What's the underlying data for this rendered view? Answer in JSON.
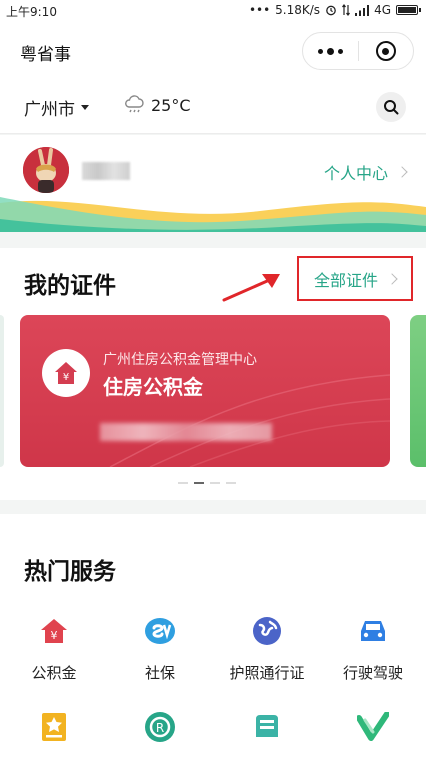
{
  "status_bar": {
    "time": "上午9:10",
    "dots": "•••",
    "speed": "5.18K/s",
    "network": "4G"
  },
  "header": {
    "title": "粤省事"
  },
  "location": {
    "city": "广州市",
    "temperature": "25°C"
  },
  "user": {
    "center_label": "个人中心"
  },
  "certificates": {
    "title": "我的证件",
    "all_label": "全部证件",
    "card": {
      "org": "广州住房公积金管理中心",
      "name": "住房公积金",
      "color": "#d43d50"
    },
    "page_count": 4,
    "active_page": 1
  },
  "services": {
    "title": "热门服务",
    "items": [
      {
        "label": "公积金",
        "icon": "house-fund-icon",
        "color": "#e0434e"
      },
      {
        "label": "社保",
        "icon": "social-security-icon",
        "color": "#2f9fe0"
      },
      {
        "label": "护照通行证",
        "icon": "passport-globe-icon",
        "color": "#4b64c8"
      },
      {
        "label": "行驶驾驶",
        "icon": "car-icon",
        "color": "#2f7fe3"
      },
      {
        "label": "",
        "icon": "star-card-icon",
        "color": "#f2b321"
      },
      {
        "label": "",
        "icon": "flower-badge-icon",
        "color": "#27a588"
      },
      {
        "label": "",
        "icon": "bus-icon",
        "color": "#3bb3a6"
      },
      {
        "label": "",
        "icon": "check-leaf-icon",
        "color": "#2fb87a"
      }
    ]
  },
  "colors": {
    "accent": "#27a588",
    "highlight_border": "#e0262a"
  }
}
